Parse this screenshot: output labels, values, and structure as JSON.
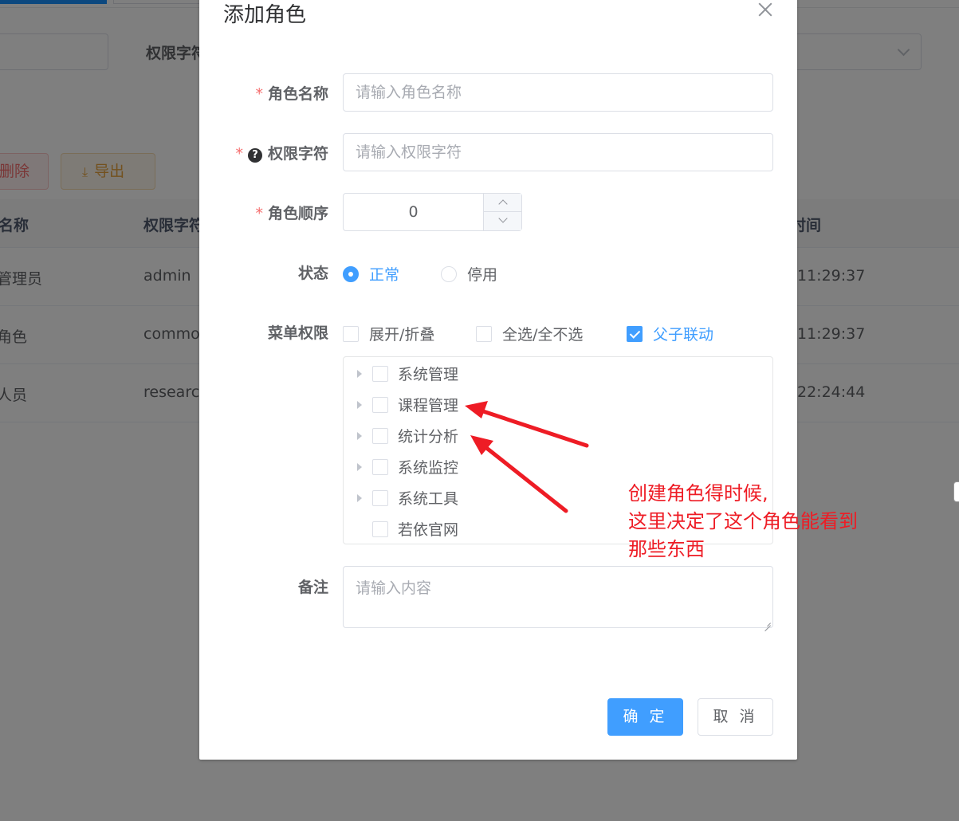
{
  "background": {
    "search_label": "权限字符",
    "delete_button": "删除",
    "export_button": "导出",
    "table": {
      "headers": [
        "名称",
        "权限字符",
        "时间"
      ],
      "rows": [
        {
          "name": "管理员",
          "key": "admin",
          "time": "11:29:37"
        },
        {
          "name": "角色",
          "key": "common",
          "time": "11:29:37"
        },
        {
          "name": "人员",
          "key": "research",
          "time": "22:24:44"
        }
      ]
    }
  },
  "dialog": {
    "title": "添加角色",
    "fields": {
      "role_name": {
        "label": "角色名称",
        "required_mark": "*",
        "placeholder": "请输入角色名称",
        "value": ""
      },
      "role_key": {
        "label": "权限字符",
        "required_mark": "*",
        "help_icon": "?",
        "placeholder": "请输入权限字符",
        "value": ""
      },
      "role_sort": {
        "label": "角色顺序",
        "required_mark": "*",
        "value": "0"
      },
      "status": {
        "label": "状态",
        "options": [
          "正常",
          "停用"
        ],
        "selected": "正常"
      },
      "menu": {
        "label": "菜单权限",
        "options": [
          {
            "label": "展开/折叠",
            "checked": false
          },
          {
            "label": "全选/全不选",
            "checked": false
          },
          {
            "label": "父子联动",
            "checked": true
          }
        ],
        "tree": [
          {
            "label": "系统管理",
            "expandable": true,
            "checked": false
          },
          {
            "label": "课程管理",
            "expandable": true,
            "checked": false
          },
          {
            "label": "统计分析",
            "expandable": true,
            "checked": false
          },
          {
            "label": "系统监控",
            "expandable": true,
            "checked": false
          },
          {
            "label": "系统工具",
            "expandable": true,
            "checked": false
          },
          {
            "label": "若依官网",
            "expandable": false,
            "checked": false
          }
        ]
      },
      "remark": {
        "label": "备注",
        "placeholder": "请输入内容",
        "value": ""
      }
    },
    "buttons": {
      "confirm": "确 定",
      "cancel": "取 消"
    }
  },
  "annotation": {
    "lines": [
      "创建角色得时候,",
      "这里决定了这个角色能看到",
      "那些东西"
    ],
    "color": "#ee1c25"
  },
  "colors": {
    "primary": "#409eff",
    "danger": "#f56c6c",
    "warning": "#e6a23c"
  }
}
